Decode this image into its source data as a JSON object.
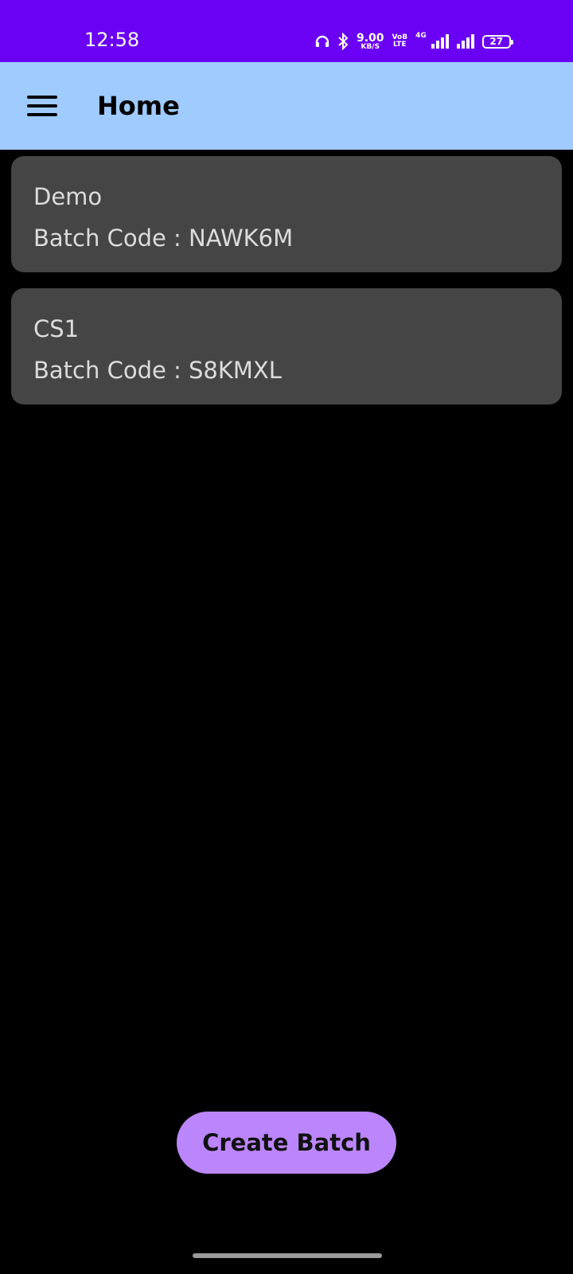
{
  "status_bar": {
    "time": "12:58",
    "net_speed_value": "9.00",
    "net_speed_unit": "KB/S",
    "volte_top": "VoB",
    "volte_bottom": "LTE",
    "network_type": "4G",
    "battery": "27",
    "icons": [
      "headphones-icon",
      "bluetooth-icon",
      "signal-icon",
      "battery-icon"
    ]
  },
  "app_bar": {
    "title": "Home",
    "menu_icon": "menu-icon",
    "background": "#9fcbff"
  },
  "batches": [
    {
      "name": "Demo",
      "code_text": "Batch Code : NAWK6M"
    },
    {
      "name": "CS1",
      "code_text": "Batch Code : S8KMXL"
    }
  ],
  "actions": {
    "create_label": "Create Batch"
  },
  "colors": {
    "status_bar": "#6a00f4",
    "card": "#454545",
    "accent_button": "#bb86fc",
    "background": "#000000"
  }
}
